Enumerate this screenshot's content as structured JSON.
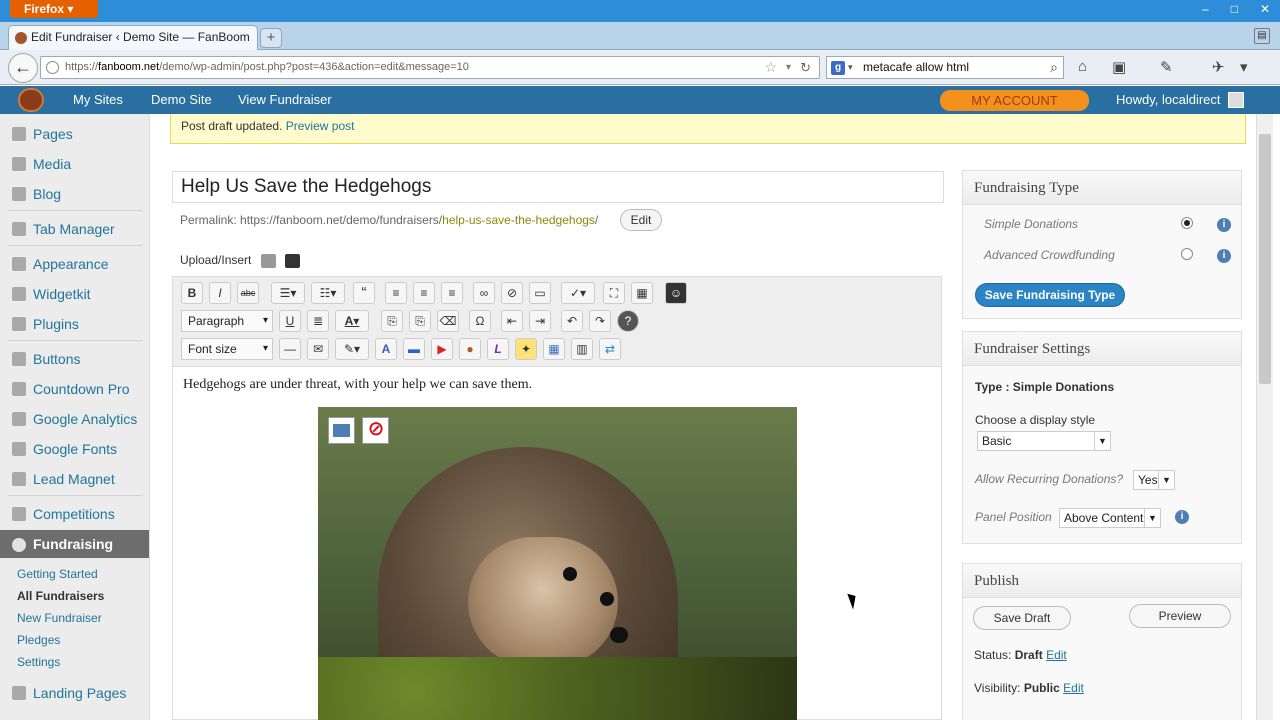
{
  "browser": {
    "app_button": "Firefox ▾",
    "tab_title": "Edit Fundraiser ‹ Demo Site — FanBoom",
    "new_tab": "+",
    "url_prefix": "https://",
    "url_domain": "fanboom.net",
    "url_rest": "/demo/wp-admin/post.php?post=436&action=edit&message=10",
    "search_query": "metacafe allow html",
    "search_engine_icon": "g-icon",
    "window_controls": [
      "–",
      "□",
      "✕"
    ]
  },
  "adminbar": {
    "items": [
      "My Sites",
      "Demo Site",
      "View Fundraiser"
    ],
    "my_account": "MY ACCOUNT",
    "howdy": "Howdy, localdirect"
  },
  "sidebar": {
    "items": [
      {
        "label": "Pages",
        "icon": "pages-icon"
      },
      {
        "label": "Media",
        "icon": "media-icon"
      },
      {
        "label": "Blog",
        "icon": "blog-icon"
      },
      {
        "label": "Tab Manager",
        "icon": "tab-manager-icon"
      },
      {
        "label": "Appearance",
        "icon": "appearance-icon"
      },
      {
        "label": "Widgetkit",
        "icon": "widgetkit-icon"
      },
      {
        "label": "Plugins",
        "icon": "plugins-icon"
      },
      {
        "label": "Buttons",
        "icon": "buttons-icon"
      },
      {
        "label": "Countdown Pro",
        "icon": "countdown-icon"
      },
      {
        "label": "Google Analytics",
        "icon": "analytics-icon"
      },
      {
        "label": "Google Fonts",
        "icon": "fonts-icon"
      },
      {
        "label": "Lead Magnet",
        "icon": "magnet-icon"
      },
      {
        "label": "Competitions",
        "icon": "competitions-icon"
      }
    ],
    "active": "Fundraising",
    "sub_items": [
      "Getting Started",
      "All Fundraisers",
      "New Fundraiser",
      "Pledges",
      "Settings"
    ],
    "bottom_item": "Landing Pages"
  },
  "main": {
    "notice_text": "Post draft updated.",
    "notice_link": "Preview post",
    "post_title": "Help Us Save the Hedgehogs",
    "permalink_label": "Permalink:",
    "permalink_base": "https://fanboom.net/demo/fundraisers/",
    "permalink_slug": "help-us-save-the-hedgehogs",
    "permalink_trail": "/",
    "edit_label": "Edit",
    "upload_label": "Upload/Insert",
    "body_text": "Hedgehogs are under threat, with your help we can save them.",
    "format_select": "Paragraph",
    "fontsize_select": "Font size"
  },
  "fundraising_type": {
    "title": "Fundraising Type",
    "options": [
      {
        "label": "Simple Donations",
        "selected": true
      },
      {
        "label": "Advanced Crowdfunding",
        "selected": false
      }
    ],
    "save_button": "Save Fundraising Type"
  },
  "fundraiser_settings": {
    "title": "Fundraiser Settings",
    "type_line": "Type : Simple Donations",
    "display_style_label": "Choose a display style",
    "display_style_value": "Basic",
    "recurring_label": "Allow Recurring Donations?",
    "recurring_value": "Yes",
    "panel_position_label": "Panel Position",
    "panel_position_value": "Above Content"
  },
  "publish": {
    "title": "Publish",
    "save_draft": "Save Draft",
    "preview": "Preview",
    "status_label": "Status:",
    "status_value": "Draft",
    "visibility_label": "Visibility:",
    "visibility_value": "Public",
    "edit_link": "Edit"
  },
  "colors": {
    "adminbar": "#2a6fa1",
    "accent_orange": "#f4911e",
    "active_menu": "#6d6d6d",
    "primary_button": "#2b84c4"
  }
}
